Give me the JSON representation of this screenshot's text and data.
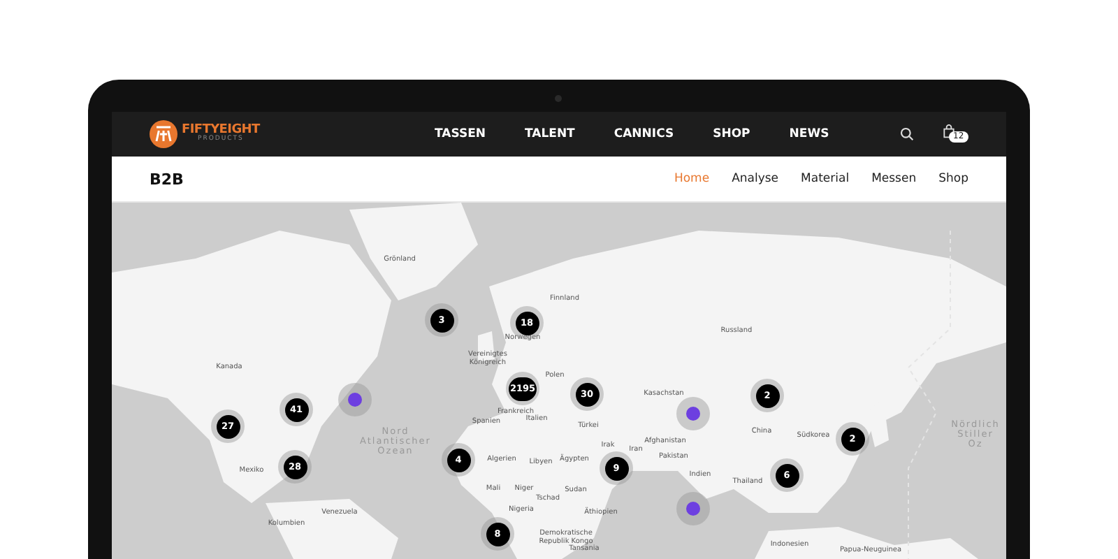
{
  "brand": {
    "name": "FIFTYEIGHT",
    "tagline": "PRODUCTS"
  },
  "main_nav": [
    {
      "label": "TASSEN"
    },
    {
      "label": "TALENT"
    },
    {
      "label": "CANNICS"
    },
    {
      "label": "SHOP"
    },
    {
      "label": "NEWS"
    }
  ],
  "cart": {
    "count": "12"
  },
  "subheader": {
    "title": "B2B",
    "tabs": [
      {
        "label": "Home",
        "selected": true
      },
      {
        "label": "Analyse",
        "selected": false
      },
      {
        "label": "Material",
        "selected": false
      },
      {
        "label": "Messen",
        "selected": false
      },
      {
        "label": "Shop",
        "selected": false
      }
    ]
  },
  "map": {
    "labels": [
      {
        "text": "Grönland",
        "kind": "country"
      },
      {
        "text": "Kanada",
        "kind": "country"
      },
      {
        "text": "Nord\nAtlantischer\nOzean",
        "kind": "ocean"
      },
      {
        "text": "Mexiko",
        "kind": "country"
      },
      {
        "text": "Venezuela",
        "kind": "country"
      },
      {
        "text": "Kolumbien",
        "kind": "country"
      },
      {
        "text": "Finnland",
        "kind": "country"
      },
      {
        "text": "Norwegen",
        "kind": "country"
      },
      {
        "text": "Vereinigtes\nKönigreich",
        "kind": "country"
      },
      {
        "text": "Polen",
        "kind": "country"
      },
      {
        "text": "Frankreich",
        "kind": "country"
      },
      {
        "text": "Spanien",
        "kind": "country"
      },
      {
        "text": "Italien",
        "kind": "country"
      },
      {
        "text": "Algerien",
        "kind": "country"
      },
      {
        "text": "Libyen",
        "kind": "country"
      },
      {
        "text": "Ägypten",
        "kind": "country"
      },
      {
        "text": "Mali",
        "kind": "country"
      },
      {
        "text": "Niger",
        "kind": "country"
      },
      {
        "text": "Tschad",
        "kind": "country"
      },
      {
        "text": "Sudan",
        "kind": "country"
      },
      {
        "text": "Nigeria",
        "kind": "country"
      },
      {
        "text": "Demokratische\nRepublik Kongo",
        "kind": "country"
      },
      {
        "text": "Äthiopien",
        "kind": "country"
      },
      {
        "text": "Tansania",
        "kind": "country"
      },
      {
        "text": "Russland",
        "kind": "country"
      },
      {
        "text": "Kasachstan",
        "kind": "country"
      },
      {
        "text": "Türkei",
        "kind": "country"
      },
      {
        "text": "Irak",
        "kind": "country"
      },
      {
        "text": "Iran",
        "kind": "country"
      },
      {
        "text": "Afghanistan",
        "kind": "country"
      },
      {
        "text": "Pakistan",
        "kind": "country"
      },
      {
        "text": "Indien",
        "kind": "country"
      },
      {
        "text": "China",
        "kind": "country"
      },
      {
        "text": "Südkorea",
        "kind": "country"
      },
      {
        "text": "Thailand",
        "kind": "country"
      },
      {
        "text": "Indonesien",
        "kind": "country"
      },
      {
        "text": "Papua-Neuguinea",
        "kind": "country"
      },
      {
        "text": "Nördlich\nStiller Oz",
        "kind": "ocean"
      }
    ],
    "markers": [
      {
        "kind": "cluster",
        "count": "3"
      },
      {
        "kind": "cluster",
        "count": "18"
      },
      {
        "kind": "cluster",
        "count": "2195"
      },
      {
        "kind": "cluster",
        "count": "30"
      },
      {
        "kind": "cluster",
        "count": "41"
      },
      {
        "kind": "cluster",
        "count": "27"
      },
      {
        "kind": "cluster",
        "count": "28"
      },
      {
        "kind": "cluster",
        "count": "4"
      },
      {
        "kind": "cluster",
        "count": "9"
      },
      {
        "kind": "cluster",
        "count": "8"
      },
      {
        "kind": "cluster",
        "count": "2"
      },
      {
        "kind": "cluster",
        "count": "2"
      },
      {
        "kind": "cluster",
        "count": "6"
      },
      {
        "kind": "point"
      },
      {
        "kind": "point"
      },
      {
        "kind": "point"
      }
    ]
  }
}
